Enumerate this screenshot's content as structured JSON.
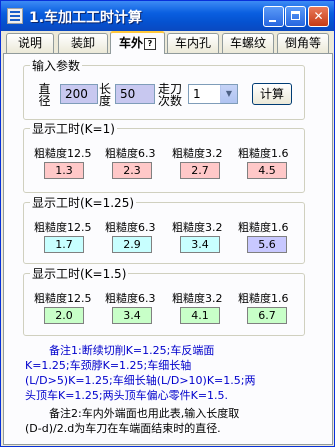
{
  "window": {
    "title": "1.车加工工时计算",
    "title_num": "1."
  },
  "tabs": [
    {
      "label": "说明"
    },
    {
      "label": "装卸"
    },
    {
      "label": "车外",
      "badge": "?"
    },
    {
      "label": "车内孔"
    },
    {
      "label": "车螺纹"
    },
    {
      "label": "倒角等"
    }
  ],
  "inputs": {
    "group_title": "输入参数",
    "diameter_label_a": "直",
    "diameter_label_b": "径",
    "diameter_value": "200",
    "length_label_a": "长",
    "length_label_b": "度",
    "length_value": "50",
    "passes_label_a": "走刀",
    "passes_label_b": "次数",
    "passes_value": "1",
    "calc_label": "计算"
  },
  "results": [
    {
      "title": "显示工时(K=1)",
      "labels": [
        "粗糙度12.5",
        "粗糙度6.3",
        "粗糙度3.2",
        "粗糙度1.6"
      ],
      "values": [
        "1.3",
        "2.3",
        "2.7",
        "4.5"
      ]
    },
    {
      "title": "显示工时(K=1.25)",
      "labels": [
        "粗糙度12.5",
        "粗糙度6.3",
        "粗糙度3.2",
        "粗糙度1.6"
      ],
      "values": [
        "1.7",
        "2.9",
        "3.4",
        "5.6"
      ]
    },
    {
      "title": "显示工时(K=1.5)",
      "labels": [
        "粗糙度12.5",
        "粗糙度6.3",
        "粗糙度3.2",
        "粗糙度1.6"
      ],
      "values": [
        "2.0",
        "3.4",
        "4.1",
        "6.7"
      ]
    }
  ],
  "colors": {
    "row1": [
      "#ffc8c8",
      "#ffc8c8",
      "#ffc8c8",
      "#ffc8c8"
    ],
    "row2": [
      "#c8ffff",
      "#c8ffff",
      "#c8ffff",
      "#c8c8ff"
    ],
    "row3": [
      "#c8ffc8",
      "#c8ffc8",
      "#c8ffc8",
      "#c8ffc8"
    ]
  },
  "notes": {
    "note1_line1": "备注1:断续切削K=1.25;车反端面",
    "note1_line2": "K=1.25;车颈脖K=1.25;车细长轴",
    "note1_line3": "(L/D>5)K=1.25;车细长轴(L/D>10)K=1.5;两",
    "note1_line4": "头顶车K=1.25;两头顶车偏心零件K=1.5.",
    "note2_line1": "备注2:车内外端面也用此表,输入长度取",
    "note2_line2": "(D-d)/2.d为车刀在车端面结束时的直径."
  }
}
